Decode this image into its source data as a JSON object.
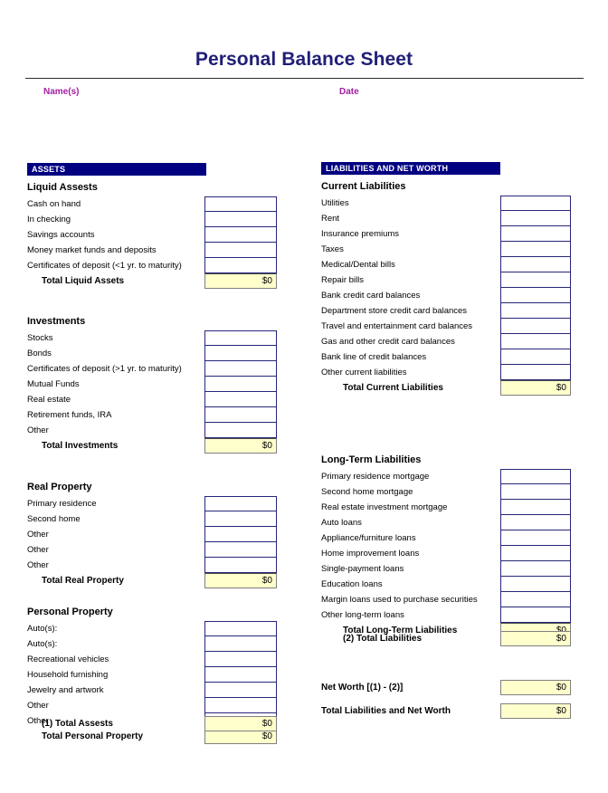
{
  "header": {
    "title": "Personal Balance Sheet",
    "names_label": "Name(s)",
    "date_label": "Date",
    "title_color": "#1f1f77",
    "label_color": "#a31fa3"
  },
  "theme": {
    "section_bar_bg": "#000080",
    "section_bar_text": "#ffffff",
    "input_border": "#26267a",
    "total_fill": "#ffffcc",
    "total_border": "#808080"
  },
  "assets": {
    "section_title": "ASSETS",
    "groups": [
      {
        "heading": "Liquid Assests",
        "rows": [
          {
            "label": "Cash on hand",
            "value": ""
          },
          {
            "label": "In checking",
            "value": ""
          },
          {
            "label": "Savings accounts",
            "value": ""
          },
          {
            "label": "Money market funds and deposits",
            "value": ""
          },
          {
            "label": "Certificates of deposit (<1 yr. to maturity)",
            "value": ""
          }
        ],
        "total": {
          "label": "Total Liquid Assets",
          "value": "$0"
        }
      },
      {
        "heading": "Investments",
        "rows": [
          {
            "label": "Stocks",
            "value": ""
          },
          {
            "label": "Bonds",
            "value": ""
          },
          {
            "label": "Certificates of deposit (>1 yr. to maturity)",
            "value": ""
          },
          {
            "label": "Mutual Funds",
            "value": ""
          },
          {
            "label": "Real estate",
            "value": ""
          },
          {
            "label": "Retirement funds, IRA",
            "value": ""
          },
          {
            "label": "Other",
            "value": ""
          }
        ],
        "total": {
          "label": "Total Investments",
          "value": "$0"
        }
      },
      {
        "heading": "Real Property",
        "rows": [
          {
            "label": "Primary residence",
            "value": ""
          },
          {
            "label": "Second home",
            "value": ""
          },
          {
            "label": "Other",
            "value": ""
          },
          {
            "label": "Other",
            "value": ""
          },
          {
            "label": "Other",
            "value": ""
          }
        ],
        "total": {
          "label": "Total Real Property",
          "value": "$0"
        }
      },
      {
        "heading": "Personal Property",
        "rows": [
          {
            "label": "Auto(s):",
            "value": ""
          },
          {
            "label": "Auto(s):",
            "value": ""
          },
          {
            "label": "Recreational vehicles",
            "value": ""
          },
          {
            "label": "Household furnishing",
            "value": ""
          },
          {
            "label": "Jewelry and artwork",
            "value": ""
          },
          {
            "label": "Other",
            "value": ""
          },
          {
            "label": "Other",
            "value": ""
          }
        ],
        "total": {
          "label": "Total Personal Property",
          "value": "$0"
        }
      }
    ],
    "grand_total": {
      "label": "(1) Total Assests",
      "value": "$0"
    }
  },
  "liabilities": {
    "section_title": "LIABILITIES AND NET WORTH",
    "groups": [
      {
        "heading": "Current Liabilities",
        "rows": [
          {
            "label": "Utilities",
            "value": ""
          },
          {
            "label": "Rent",
            "value": ""
          },
          {
            "label": "Insurance premiums",
            "value": ""
          },
          {
            "label": "Taxes",
            "value": ""
          },
          {
            "label": "Medical/Dental bills",
            "value": ""
          },
          {
            "label": "Repair bills",
            "value": ""
          },
          {
            "label": "Bank credit card balances",
            "value": ""
          },
          {
            "label": "Department store credit card balances",
            "value": ""
          },
          {
            "label": "Travel and entertainment card balances",
            "value": ""
          },
          {
            "label": "Gas and other credit card balances",
            "value": ""
          },
          {
            "label": "Bank line of credit balances",
            "value": ""
          },
          {
            "label": "Other current liabilities",
            "value": ""
          }
        ],
        "total": {
          "label": "Total Current Liabilities",
          "value": "$0"
        }
      },
      {
        "heading": "Long-Term Liabilities",
        "rows": [
          {
            "label": "Primary residence mortgage",
            "value": ""
          },
          {
            "label": "Second home mortgage",
            "value": ""
          },
          {
            "label": "Real estate investment mortgage",
            "value": ""
          },
          {
            "label": "Auto loans",
            "value": ""
          },
          {
            "label": "Appliance/furniture loans",
            "value": ""
          },
          {
            "label": "Home improvement loans",
            "value": ""
          },
          {
            "label": "Single-payment loans",
            "value": ""
          },
          {
            "label": "Education loans",
            "value": ""
          },
          {
            "label": "Margin loans used to purchase securities",
            "value": ""
          },
          {
            "label": "Other long-term loans",
            "value": ""
          }
        ],
        "total": {
          "label": "Total Long-Term Liabilities",
          "value": "$0"
        }
      }
    ],
    "grand_total": {
      "label": "(2) Total Liabilities",
      "value": "$0"
    },
    "net_worth": {
      "label": "Net Worth [(1) - (2)]",
      "value": "$0"
    },
    "total_liab_net_worth": {
      "label": "Total Liabilities and Net Worth",
      "value": "$0"
    }
  }
}
